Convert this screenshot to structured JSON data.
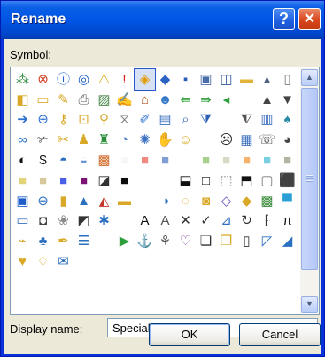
{
  "window": {
    "title": "Rename"
  },
  "titlebar_buttons": {
    "help": "?",
    "close": "✕"
  },
  "symbol_label": "Symbol:",
  "symbols": [
    {
      "g": "⁂",
      "c": "#2a8c3a",
      "n": "org-chart-icon"
    },
    {
      "g": "⊗",
      "c": "#d23b1e",
      "n": "cancel-circle-icon"
    },
    {
      "g": "ⓘ",
      "c": "#1d5cc9",
      "n": "info-icon"
    },
    {
      "g": "◎",
      "c": "#1d5cc9",
      "n": "record-icon"
    },
    {
      "g": "⚠",
      "c": "#d8a400",
      "n": "warning-icon"
    },
    {
      "g": "!",
      "c": "#d21e1e",
      "n": "exclamation-icon"
    },
    {
      "g": "◈",
      "c": "#e39b00",
      "n": "warning-diamond-icon",
      "selected": true
    },
    {
      "g": "◆",
      "c": "#2a63c4",
      "n": "shield-icon"
    },
    {
      "g": "▪",
      "c": "#2a5fb8",
      "n": "save-icon"
    },
    {
      "g": "▣",
      "c": "#4a6ea9",
      "n": "save-all-icon"
    },
    {
      "g": "◫",
      "c": "#2f5a9e",
      "n": "save-as-icon"
    },
    {
      "g": "▬",
      "c": "#e2b43a",
      "n": "folder-icon"
    },
    {
      "g": "▴",
      "c": "#4d6185",
      "n": "scroll-up-icon"
    },
    {
      "g": "",
      "c": "#000",
      "n": "empty-icon"
    },
    {
      "g": "▯",
      "c": "#7a7a7a",
      "n": "new-document-icon"
    },
    {
      "g": "◧",
      "c": "#d9a827",
      "n": "open-folder-icon"
    },
    {
      "g": "▭",
      "c": "#d9a827",
      "n": "folders-icon"
    },
    {
      "g": "✎",
      "c": "#d9a827",
      "n": "edit-folder-icon"
    },
    {
      "g": "⎙",
      "c": "#555",
      "n": "print-icon"
    },
    {
      "g": "▨",
      "c": "#4c8a4c",
      "n": "picture-icon"
    },
    {
      "g": "✍",
      "c": "#3d6fb3",
      "n": "signature-icon"
    },
    {
      "g": "⌂",
      "c": "#b5561c",
      "n": "home-icon"
    },
    {
      "g": "☻",
      "c": "#3578c7",
      "n": "globe-icon"
    },
    {
      "g": "⇚",
      "c": "#2e9e3b",
      "n": "double-back-icon"
    },
    {
      "g": "⇛",
      "c": "#2e9e3b",
      "n": "double-forward-icon"
    },
    {
      "g": "◂",
      "c": "#2e9e3b",
      "n": "back-icon"
    },
    {
      "g": "",
      "c": "#000",
      "n": "empty-icon"
    },
    {
      "g": "",
      "c": "#000",
      "n": "empty-icon"
    },
    {
      "g": "▲",
      "c": "#444",
      "n": "triangle-up-icon"
    },
    {
      "g": "▼",
      "c": "#444",
      "n": "triangle-down-icon"
    },
    {
      "g": "➔",
      "c": "#2c6fd0",
      "n": "arrow-right-icon"
    },
    {
      "g": "⊕",
      "c": "#2c6fd0",
      "n": "circle-arrow-icon"
    },
    {
      "g": "⚷",
      "c": "#d9a827",
      "n": "key-icon"
    },
    {
      "g": "⊡",
      "c": "#d9a827",
      "n": "lock-icon"
    },
    {
      "g": "⚲",
      "c": "#d9a827",
      "n": "pin-icon"
    },
    {
      "g": "⧖",
      "c": "#777",
      "n": "hourglass-icon"
    },
    {
      "g": "✐",
      "c": "#2c6fd0",
      "n": "pen-icon"
    },
    {
      "g": "▤",
      "c": "#3a6fc0",
      "n": "list-icon"
    },
    {
      "g": "⌕",
      "c": "#3a6fc0",
      "n": "search-icon"
    },
    {
      "g": "⧩",
      "c": "#2b5fb5",
      "n": "filter-icon"
    },
    {
      "g": "",
      "c": "#000",
      "n": "empty-icon"
    },
    {
      "g": "",
      "c": "#000",
      "n": "empty-icon"
    },
    {
      "g": "⧨",
      "c": "#555",
      "n": "funnel-icon"
    },
    {
      "g": "▥",
      "c": "#3a6fc0",
      "n": "book-icon"
    },
    {
      "g": "♠",
      "c": "#2a8aa8",
      "n": "plant-icon"
    },
    {
      "g": "∞",
      "c": "#2a6fc0",
      "n": "link-icon"
    },
    {
      "g": "✃",
      "c": "#555",
      "n": "scissors-icon"
    },
    {
      "g": "✂",
      "c": "#d9a827",
      "n": "tools-icon"
    },
    {
      "g": "♟",
      "c": "#d9a827",
      "n": "person-icon"
    },
    {
      "g": "♜",
      "c": "#2a8c3a",
      "n": "people-icon"
    },
    {
      "g": "◔",
      "c": "#3a6fc0",
      "n": "clock-icon"
    },
    {
      "g": "✺",
      "c": "#3a6fc0",
      "n": "snowflake-icon"
    },
    {
      "g": "✋",
      "c": "#d9a827",
      "n": "hand-icon"
    },
    {
      "g": "☺",
      "c": "#d9a827",
      "n": "smiley-icon"
    },
    {
      "g": "",
      "c": "#000",
      "n": "empty-icon"
    },
    {
      "g": "",
      "c": "#000",
      "n": "empty-icon"
    },
    {
      "g": "☹",
      "c": "#222",
      "n": "frown-icon"
    },
    {
      "g": "▦",
      "c": "#3a6fc0",
      "n": "calculator-icon"
    },
    {
      "g": "☏",
      "c": "#444",
      "n": "phone-icon"
    },
    {
      "g": "◕",
      "c": "#444",
      "n": "speech-icon"
    },
    {
      "g": "◐",
      "c": "#111",
      "n": "contrast-icon"
    },
    {
      "g": "$",
      "c": "#111",
      "n": "currency-icon"
    },
    {
      "g": "◓",
      "c": "#2a6fc0",
      "n": "eye-icon"
    },
    {
      "g": "◒",
      "c": "#6a95d9",
      "n": "half-circle-icon"
    },
    {
      "g": "▩",
      "c": "#d26b2b",
      "n": "color-squares-icon"
    },
    {
      "g": "■",
      "c": "#f7f7f7",
      "n": "white-swatch-icon"
    },
    {
      "g": "■",
      "c": "#f08a80",
      "n": "salmon-swatch-icon"
    },
    {
      "g": "■",
      "c": "#7f9fd4",
      "n": "blue-swatch-icon"
    },
    {
      "g": "",
      "c": "#000",
      "n": "empty-icon"
    },
    {
      "g": "",
      "c": "#000",
      "n": "empty-icon"
    },
    {
      "g": "■",
      "c": "#a6d08c",
      "n": "green-swatch-icon"
    },
    {
      "g": "■",
      "c": "#d9d9c4",
      "n": "tan-swatch-icon"
    },
    {
      "g": "■",
      "c": "#f5b26b",
      "n": "orange-swatch-icon"
    },
    {
      "g": "■",
      "c": "#79cfe0",
      "n": "cyan-swatch-icon"
    },
    {
      "g": "■",
      "c": "#b3b3a1",
      "n": "gray-swatch-icon"
    },
    {
      "g": "■",
      "c": "#e3d37a",
      "n": "yellow-swatch-icon"
    },
    {
      "g": "■",
      "c": "#d6c89a",
      "n": "beige-swatch-icon"
    },
    {
      "g": "■",
      "c": "#4b60e8",
      "n": "royal-blue-swatch-icon"
    },
    {
      "g": "■",
      "c": "#7a1575",
      "n": "purple-swatch-icon"
    },
    {
      "g": "◪",
      "c": "#333",
      "n": "black-white-swatch-icon"
    },
    {
      "g": "■",
      "c": "#0d0d0d",
      "n": "black-swatch-icon"
    },
    {
      "g": "",
      "c": "#000",
      "n": "empty-icon"
    },
    {
      "g": "",
      "c": "#000",
      "n": "empty-icon"
    },
    {
      "g": "",
      "c": "#000",
      "n": "empty-icon"
    },
    {
      "g": "⬓",
      "c": "#111",
      "n": "half-black-icon"
    },
    {
      "g": "□",
      "c": "#111",
      "n": "frame-icon"
    },
    {
      "g": "⬚",
      "c": "#777",
      "n": "dotted-frame-icon"
    },
    {
      "g": "⬒",
      "c": "#111",
      "n": "top-black-icon"
    },
    {
      "g": "▢",
      "c": "#777",
      "n": "outline-square-icon"
    },
    {
      "g": "⬛",
      "c": "#111",
      "n": "filled-square-icon"
    },
    {
      "g": "▣",
      "c": "#1d5cc9",
      "n": "framed-square-icon"
    },
    {
      "g": "⊖",
      "c": "#2a6fc0",
      "n": "go-icon"
    },
    {
      "g": "▮",
      "c": "#d9a827",
      "n": "chart-icon"
    },
    {
      "g": "▲",
      "c": "#2a6fc0",
      "n": "pyramid-icon"
    },
    {
      "g": "◭",
      "c": "#c0392b",
      "n": "area-chart-icon"
    },
    {
      "g": "▬",
      "c": "#d9a827",
      "n": "bar-chart-icon"
    },
    {
      "g": "",
      "c": "#000",
      "n": "empty-icon"
    },
    {
      "g": "",
      "c": "#000",
      "n": "empty-icon"
    },
    {
      "g": "◑",
      "c": "#2a6fc0",
      "n": "pie-chart-icon"
    },
    {
      "g": "◌",
      "c": "#d9a827",
      "n": "doughnut-icon"
    },
    {
      "g": "◙",
      "c": "#d9a827",
      "n": "cylinder-icon"
    },
    {
      "g": "◇",
      "c": "#6a4fc0",
      "n": "layers-icon"
    },
    {
      "g": "◆",
      "c": "#d9a827",
      "n": "gift-icon"
    },
    {
      "g": "▩",
      "c": "#3a8c3a",
      "n": "map-icon"
    },
    {
      "g": "▀",
      "c": "#2a9fd6",
      "n": "monitor-icon"
    },
    {
      "g": "▭",
      "c": "#3a6fc0",
      "n": "window-icon"
    },
    {
      "g": "◘",
      "c": "#444",
      "n": "photo-frame-icon"
    },
    {
      "g": "❀",
      "c": "#888",
      "n": "gear-flower-icon"
    },
    {
      "g": "◩",
      "c": "#333",
      "n": "bw-diagonal-icon"
    },
    {
      "g": "✱",
      "c": "#2a6fc0",
      "n": "sparkle-icon"
    },
    {
      "g": "",
      "c": "#000",
      "n": "empty-icon"
    },
    {
      "g": "",
      "c": "#000",
      "n": "empty-icon"
    },
    {
      "g": "A",
      "c": "#111",
      "n": "letter-a-icon"
    },
    {
      "g": "A",
      "c": "#555",
      "n": "letter-a-shadow-icon"
    },
    {
      "g": "✕",
      "c": "#333",
      "n": "cross-icon"
    },
    {
      "g": "✓",
      "c": "#333",
      "n": "checkmark-icon"
    },
    {
      "g": "⊿",
      "c": "#2a6fc0",
      "n": "chart-check-icon"
    },
    {
      "g": "↻",
      "c": "#333",
      "n": "refresh-icon"
    },
    {
      "g": "⁅",
      "c": "#333",
      "n": "bracket-number-icon"
    },
    {
      "g": "π",
      "c": "#111",
      "n": "pi-icon"
    },
    {
      "g": "⌁",
      "c": "#d9a827",
      "n": "paint-bucket-icon"
    },
    {
      "g": "♣",
      "c": "#2a6fc0",
      "n": "binoculars-icon"
    },
    {
      "g": "✒",
      "c": "#d9a827",
      "n": "brush-icon"
    },
    {
      "g": "☰",
      "c": "#2a6fc0",
      "n": "bullet-list-icon"
    },
    {
      "g": "",
      "c": "#000",
      "n": "empty-icon"
    },
    {
      "g": "",
      "c": "#000",
      "n": "empty-icon"
    },
    {
      "g": "▶",
      "c": "#2e9e3b",
      "n": "play-icon"
    },
    {
      "g": "⚓",
      "c": "#2a6fc0",
      "n": "anchor-icon"
    },
    {
      "g": "⚘",
      "c": "#555",
      "n": "magnifier-doc-icon"
    },
    {
      "g": "♡",
      "c": "#7a3fa0",
      "n": "ribbon-icon"
    },
    {
      "g": "❏",
      "c": "#333",
      "n": "copy-icon"
    },
    {
      "g": "❐",
      "c": "#d9a827",
      "n": "clipboard-icon"
    },
    {
      "g": "▯",
      "c": "#333",
      "n": "document-icon"
    },
    {
      "g": "◸",
      "c": "#2a6fc0",
      "n": "corner-icon"
    },
    {
      "g": "◢",
      "c": "#2a6fc0",
      "n": "pen-nib-icon"
    },
    {
      "g": "♥",
      "c": "#d9a827",
      "n": "heart-icon"
    },
    {
      "g": "♢",
      "c": "#d9a827",
      "n": "bell-icon"
    },
    {
      "g": "✉",
      "c": "#2a6fc0",
      "n": "envelope-icon"
    },
    {
      "g": "",
      "c": "#000",
      "n": "empty-icon"
    },
    {
      "g": "",
      "c": "#000",
      "n": "empty-icon"
    }
  ],
  "display_name": {
    "label": "Display name:",
    "value": "Special Buttons |"
  },
  "buttons": {
    "ok": "OK",
    "cancel": "Cancel"
  },
  "colors": {
    "title_bar": "#0055e5",
    "dialog_bg": "#ece9d8",
    "close_button": "#d9461c"
  }
}
